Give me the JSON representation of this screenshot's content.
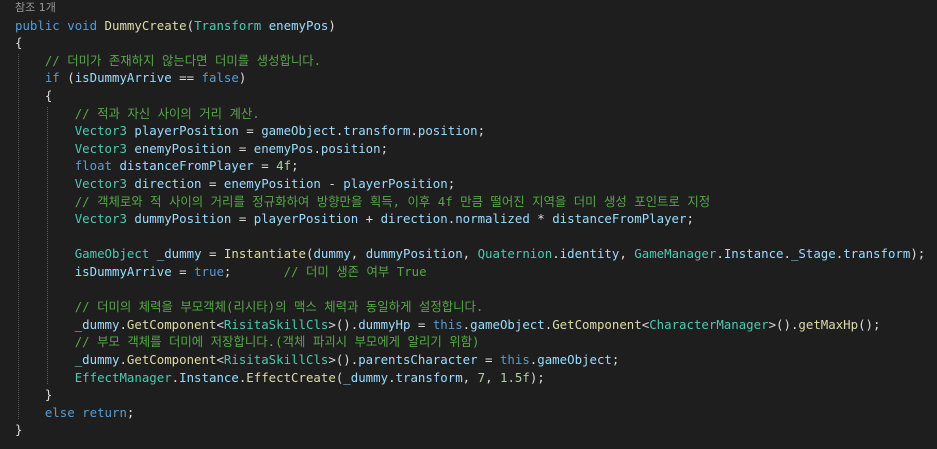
{
  "codelens": "참조 1개",
  "colors": {
    "background": "#1e1e1e",
    "keyword": "#569cd6",
    "type": "#4ec9b0",
    "comment": "#57a64a",
    "number": "#b5cea8",
    "method": "#dcdcaa",
    "text": "#dcdcdc",
    "field": "#9cdcfe"
  },
  "lines": [
    [
      [
        "kw",
        "public"
      ],
      [
        "pl",
        " "
      ],
      [
        "kw",
        "void"
      ],
      [
        "pl",
        " "
      ],
      [
        "fn",
        "DummyCreate"
      ],
      [
        "pl",
        "("
      ],
      [
        "ty",
        "Transform"
      ],
      [
        "pl",
        " "
      ],
      [
        "pa",
        "enemyPos"
      ],
      [
        "pl",
        ")"
      ]
    ],
    [
      [
        "pl",
        "{"
      ]
    ],
    [
      [
        "pl",
        "    "
      ],
      [
        "cm",
        "// 더미가 존재하지 않는다면 더미를 생성합니다."
      ]
    ],
    [
      [
        "pl",
        "    "
      ],
      [
        "kw",
        "if"
      ],
      [
        "pl",
        " ("
      ],
      [
        "vr",
        "isDummyArrive"
      ],
      [
        "pl",
        " == "
      ],
      [
        "kw",
        "false"
      ],
      [
        "pl",
        ")"
      ]
    ],
    [
      [
        "pl",
        "    {"
      ]
    ],
    [
      [
        "pl",
        "        "
      ],
      [
        "cm",
        "// 적과 자신 사이의 거리 계산."
      ]
    ],
    [
      [
        "pl",
        "        "
      ],
      [
        "ty",
        "Vector3"
      ],
      [
        "pl",
        " "
      ],
      [
        "vr",
        "playerPosition"
      ],
      [
        "pl",
        " = "
      ],
      [
        "vr",
        "gameObject"
      ],
      [
        "pl",
        "."
      ],
      [
        "vr",
        "transform"
      ],
      [
        "pl",
        "."
      ],
      [
        "vr",
        "position"
      ],
      [
        "pl",
        ";"
      ]
    ],
    [
      [
        "pl",
        "        "
      ],
      [
        "ty",
        "Vector3"
      ],
      [
        "pl",
        " "
      ],
      [
        "vr",
        "enemyPosition"
      ],
      [
        "pl",
        " = "
      ],
      [
        "pa",
        "enemyPos"
      ],
      [
        "pl",
        "."
      ],
      [
        "vr",
        "position"
      ],
      [
        "pl",
        ";"
      ]
    ],
    [
      [
        "pl",
        "        "
      ],
      [
        "kw",
        "float"
      ],
      [
        "pl",
        " "
      ],
      [
        "vr",
        "distanceFromPlayer"
      ],
      [
        "pl",
        " = "
      ],
      [
        "nu",
        "4f"
      ],
      [
        "pl",
        ";"
      ]
    ],
    [
      [
        "pl",
        "        "
      ],
      [
        "ty",
        "Vector3"
      ],
      [
        "pl",
        " "
      ],
      [
        "vr",
        "direction"
      ],
      [
        "pl",
        " = "
      ],
      [
        "vr",
        "enemyPosition"
      ],
      [
        "pl",
        " - "
      ],
      [
        "vr",
        "playerPosition"
      ],
      [
        "pl",
        ";"
      ]
    ],
    [
      [
        "pl",
        "        "
      ],
      [
        "cm",
        "// 객체로와 적 사이의 거리를 정규화하여 방향만을 획득, 이후 4f 만큼 떨어진 지역을 더미 생성 포인트로 지정"
      ]
    ],
    [
      [
        "pl",
        "        "
      ],
      [
        "ty",
        "Vector3"
      ],
      [
        "pl",
        " "
      ],
      [
        "vr",
        "dummyPosition"
      ],
      [
        "pl",
        " = "
      ],
      [
        "vr",
        "playerPosition"
      ],
      [
        "pl",
        " + "
      ],
      [
        "vr",
        "direction"
      ],
      [
        "pl",
        "."
      ],
      [
        "vr",
        "normalized"
      ],
      [
        "pl",
        " * "
      ],
      [
        "vr",
        "distanceFromPlayer"
      ],
      [
        "pl",
        ";"
      ]
    ],
    [],
    [
      [
        "pl",
        "        "
      ],
      [
        "ty",
        "GameObject"
      ],
      [
        "pl",
        " "
      ],
      [
        "vr",
        "_dummy"
      ],
      [
        "pl",
        " = "
      ],
      [
        "fn",
        "Instantiate"
      ],
      [
        "pl",
        "("
      ],
      [
        "vr",
        "dummy"
      ],
      [
        "pl",
        ", "
      ],
      [
        "vr",
        "dummyPosition"
      ],
      [
        "pl",
        ", "
      ],
      [
        "ty",
        "Quaternion"
      ],
      [
        "pl",
        "."
      ],
      [
        "vr",
        "identity"
      ],
      [
        "pl",
        ", "
      ],
      [
        "ty",
        "GameManager"
      ],
      [
        "pl",
        "."
      ],
      [
        "vr",
        "Instance"
      ],
      [
        "pl",
        "."
      ],
      [
        "vr",
        "_Stage"
      ],
      [
        "pl",
        "."
      ],
      [
        "vr",
        "transform"
      ],
      [
        "pl",
        ");"
      ]
    ],
    [
      [
        "pl",
        "        "
      ],
      [
        "vr",
        "isDummyArrive"
      ],
      [
        "pl",
        " = "
      ],
      [
        "kw",
        "true"
      ],
      [
        "pl",
        ";       "
      ],
      [
        "cm",
        "// 더미 생존 여부 True"
      ]
    ],
    [],
    [
      [
        "pl",
        "        "
      ],
      [
        "cm",
        "// 더미의 체력을 부모객체(리시타)의 맥스 체력과 동일하게 설정합니다."
      ]
    ],
    [
      [
        "pl",
        "        "
      ],
      [
        "vr",
        "_dummy"
      ],
      [
        "pl",
        "."
      ],
      [
        "fn",
        "GetComponent"
      ],
      [
        "pl",
        "<"
      ],
      [
        "ty",
        "RisitaSkillCls"
      ],
      [
        "pl",
        ">()."
      ],
      [
        "vr",
        "dummyHp"
      ],
      [
        "pl",
        " = "
      ],
      [
        "kw",
        "this"
      ],
      [
        "pl",
        "."
      ],
      [
        "vr",
        "gameObject"
      ],
      [
        "pl",
        "."
      ],
      [
        "fn",
        "GetComponent"
      ],
      [
        "pl",
        "<"
      ],
      [
        "ty",
        "CharacterManager"
      ],
      [
        "pl",
        ">()."
      ],
      [
        "fn",
        "getMaxHp"
      ],
      [
        "pl",
        "();"
      ]
    ],
    [
      [
        "pl",
        "        "
      ],
      [
        "cm",
        "// 부모 객체를 더미에 저장합니다.(객체 파괴시 부모에게 알리기 위함)"
      ]
    ],
    [
      [
        "pl",
        "        "
      ],
      [
        "vr",
        "_dummy"
      ],
      [
        "pl",
        "."
      ],
      [
        "fn",
        "GetComponent"
      ],
      [
        "pl",
        "<"
      ],
      [
        "ty",
        "RisitaSkillCls"
      ],
      [
        "pl",
        ">()."
      ],
      [
        "vr",
        "parentsCharacter"
      ],
      [
        "pl",
        " = "
      ],
      [
        "kw",
        "this"
      ],
      [
        "pl",
        "."
      ],
      [
        "vr",
        "gameObject"
      ],
      [
        "pl",
        ";"
      ]
    ],
    [
      [
        "pl",
        "        "
      ],
      [
        "ty",
        "EffectManager"
      ],
      [
        "pl",
        "."
      ],
      [
        "vr",
        "Instance"
      ],
      [
        "pl",
        "."
      ],
      [
        "fn",
        "EffectCreate"
      ],
      [
        "pl",
        "("
      ],
      [
        "vr",
        "_dummy"
      ],
      [
        "pl",
        "."
      ],
      [
        "vr",
        "transform"
      ],
      [
        "pl",
        ", "
      ],
      [
        "nu",
        "7"
      ],
      [
        "pl",
        ", "
      ],
      [
        "nu",
        "1.5f"
      ],
      [
        "pl",
        ");"
      ]
    ],
    [
      [
        "pl",
        "    }"
      ]
    ],
    [
      [
        "pl",
        "    "
      ],
      [
        "kw",
        "else"
      ],
      [
        "pl",
        " "
      ],
      [
        "kw",
        "return"
      ],
      [
        "pl",
        ";"
      ]
    ],
    [
      [
        "pl",
        "}"
      ]
    ]
  ]
}
